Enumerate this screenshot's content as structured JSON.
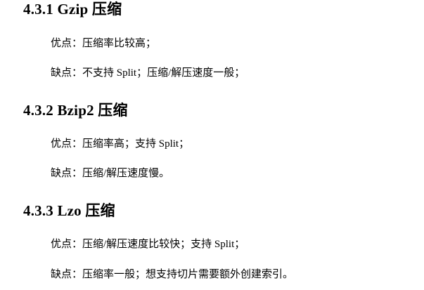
{
  "sections": [
    {
      "heading": "4.3.1 Gzip 压缩",
      "pros": "优点：压缩率比较高；",
      "cons": "缺点：不支持 Split；压缩/解压速度一般；"
    },
    {
      "heading": "4.3.2 Bzip2 压缩",
      "pros": "优点：压缩率高；支持 Split；",
      "cons": "缺点：压缩/解压速度慢。"
    },
    {
      "heading": "4.3.3 Lzo 压缩",
      "pros": "优点：压缩/解压速度比较快；支持 Split；",
      "cons": "缺点：压缩率一般；想支持切片需要额外创建索引。"
    }
  ]
}
